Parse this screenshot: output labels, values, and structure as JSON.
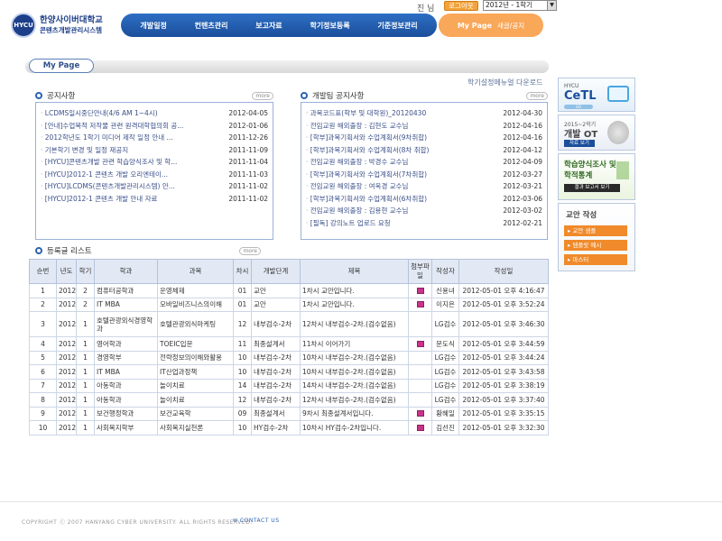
{
  "header": {
    "logo_line1": "한양사이버대학교",
    "logo_line2": "콘텐츠개발관리시스템",
    "logo_mark": "HYCU",
    "user_name": "진 님",
    "logout_label": "로그아웃",
    "term_selected": "2012년 - 1학기",
    "nav": [
      "개발일정",
      "컨텐츠관리",
      "보고자료",
      "학기정보등록",
      "기준정보관리"
    ],
    "mypage_label": "My Page",
    "mypage_sub": "새글/공지"
  },
  "page": {
    "title": "My Page",
    "links": "학기설정메뉴얼 다운로드"
  },
  "notice": {
    "title": "공지사항",
    "more": "more",
    "items": [
      {
        "title": "LCDMS일시중단안내(4/6 AM 1~4시)",
        "date": "2012-04-05"
      },
      {
        "title": "[안내]수업목적 저작물 관련 원격대학협의회 공...",
        "date": "2012-01-06"
      },
      {
        "title": "2012학년도 1학기 미디어 제작 일정 안내 ...",
        "date": "2011-12-26"
      },
      {
        "title": "기본학기 변경 및 일정 재공지",
        "date": "2011-11-09"
      },
      {
        "title": "[HYCU]콘텐츠개발 관련 학습양식조사 및 학...",
        "date": "2011-11-04"
      },
      {
        "title": "[HYCU]2012-1 콘텐츠 개발 오리엔테이...",
        "date": "2011-11-03"
      },
      {
        "title": "[HYCU]LCDMS(콘텐츠개발관리시스템) 안...",
        "date": "2011-11-02"
      },
      {
        "title": "[HYCU]2012-1 콘텐츠 개발 안내 자료",
        "date": "2011-11-02"
      }
    ]
  },
  "dev_notice": {
    "title": "개발팀 공지사항",
    "more": "more",
    "items": [
      {
        "title": "과목코드표(학부 및 대학원)_20120430",
        "date": "2012-04-30"
      },
      {
        "title": "전임교원 해외출장 : 김현도 교수님",
        "date": "2012-04-16"
      },
      {
        "title": "[학부]과목기획서와 수업계획서(9차취합)",
        "date": "2012-04-16"
      },
      {
        "title": "[학부]과목기획서와 수업계획서(8차 취합)",
        "date": "2012-04-12"
      },
      {
        "title": "전임교원 해외출장 : 박경수 교수님",
        "date": "2012-04-09"
      },
      {
        "title": "[학부]과목기획서와 수업계획서(7차취합)",
        "date": "2012-03-27"
      },
      {
        "title": "전임교원 해외출장 : 여옥경 교수님",
        "date": "2012-03-21"
      },
      {
        "title": "[학부]과목기획서와 수업계획서(6차취합)",
        "date": "2012-03-06"
      },
      {
        "title": "전임교원 해외출장 : 김용현 교수님",
        "date": "2012-03-02"
      },
      {
        "title": "[필독] 강의노트 업로드 요청",
        "date": "2012-02-21"
      }
    ]
  },
  "registered": {
    "title": "등록글 리스트",
    "more": "more",
    "columns": [
      "순번",
      "년도",
      "학기",
      "학과",
      "과목",
      "차시",
      "개발단계",
      "제목",
      "첨부파일",
      "작성자",
      "작성일"
    ],
    "rows": [
      [
        "1",
        "2012",
        "2",
        "컴퓨터공학과",
        "운영체제",
        "01",
        "교안",
        "1차시 교안입니다.",
        "Y",
        "신용녀",
        "2012-05-01 오후 4:16:47"
      ],
      [
        "2",
        "2012",
        "2",
        "IT MBA",
        "모바일비즈니스의이해",
        "01",
        "교안",
        "1차시 교안입니다.",
        "Y",
        "이지은",
        "2012-05-01 오후 3:52:24"
      ],
      [
        "3",
        "2012",
        "1",
        "호텔관광외식경영학과",
        "호텔관광외식마케팅",
        "12",
        "내부검수-2차",
        "12차시 내부검수-2차.(검수없음)",
        "",
        "LG검수",
        "2012-05-01 오후 3:46:30"
      ],
      [
        "4",
        "2012",
        "1",
        "영어학과",
        "TOEIC입문",
        "11",
        "최종설계서",
        "11차시 이어가기",
        "Y",
        "문도식",
        "2012-05-01 오후 3:44:59"
      ],
      [
        "5",
        "2012",
        "1",
        "경영학부",
        "전략정보의이해와활용",
        "10",
        "내부검수-2차",
        "10차시 내부검수-2차.(검수없음)",
        "",
        "LG검수",
        "2012-05-01 오후 3:44:24"
      ],
      [
        "6",
        "2012",
        "1",
        "IT MBA",
        "IT산업과정책",
        "10",
        "내부검수-2차",
        "10차시 내부검수-2차.(검수없음)",
        "",
        "LG검수",
        "2012-05-01 오후 3:43:58"
      ],
      [
        "7",
        "2012",
        "1",
        "아동학과",
        "놀이치료",
        "14",
        "내부검수-2차",
        "14차시 내부검수-2차.(검수없음)",
        "",
        "LG검수",
        "2012-05-01 오후 3:38:19"
      ],
      [
        "8",
        "2012",
        "1",
        "아동학과",
        "놀이치료",
        "12",
        "내부검수-2차",
        "12차시 내부검수-2차.(검수없음)",
        "",
        "LG검수",
        "2012-05-01 오후 3:37:40"
      ],
      [
        "9",
        "2012",
        "1",
        "보건행정학과",
        "보건교육학",
        "09",
        "최종설계서",
        "9차시 최종설계서입니다.",
        "Y",
        "황혜일",
        "2012-05-01 오후 3:35:15"
      ],
      [
        "10",
        "2012",
        "1",
        "사회복지학부",
        "사회복지실천론",
        "10",
        "HY검수-2차",
        "10차시 HY검수-2차입니다.",
        "Y",
        "김선진",
        "2012-05-01 오후 3:32:30"
      ]
    ]
  },
  "sidebar": {
    "cetl_top": "HYCU",
    "cetl_title": "CeTL",
    "cetl_go": "GO",
    "ot_top": "2015~2학기",
    "ot_title": "개발 OT",
    "ot_button": "자료 보기",
    "survey_title1": "학습양식조사 및",
    "survey_title2": "학적통계",
    "survey_button": "결과 보고서 보기",
    "lecture_title": "교안 작성",
    "lecture_items": [
      "교안 샘플",
      "템플릿 예시",
      "마스터"
    ]
  },
  "footer": {
    "copyright": "COPYRIGHT ⓒ 2007 HANYANG CYBER UNIVERSITY. ALL RIGHTS RESERVED.",
    "contact": "CONTACT US"
  },
  "colors": {
    "nav_blue": "#1b4e9b",
    "accent_orange": "#f9a758",
    "attach_icon": "#c9348b"
  }
}
